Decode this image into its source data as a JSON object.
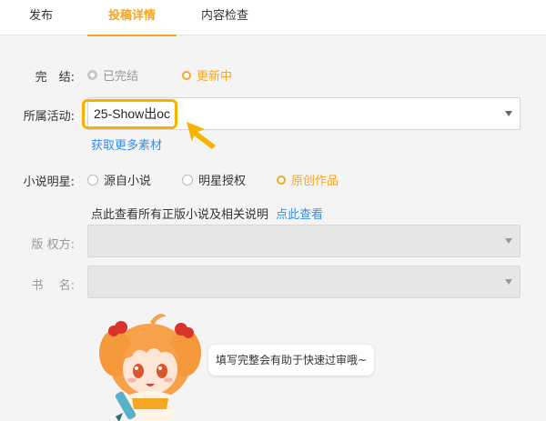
{
  "tabs": [
    {
      "label": "发布"
    },
    {
      "label": "投稿详情"
    },
    {
      "label": "内容检查"
    }
  ],
  "form": {
    "completion": {
      "label": "完　结:",
      "options": [
        "已完结",
        "更新中"
      ],
      "selected": "更新中"
    },
    "activity": {
      "label": "所属活动:",
      "value": "25-Show出oc",
      "more_link": "获取更多素材"
    },
    "novel_star": {
      "label": "小说明星:",
      "options": [
        "源自小说",
        "明星授权",
        "原创作品"
      ],
      "selected": "原创作品"
    },
    "notice": {
      "text": "点此查看所有正版小说及相关说明",
      "link": "点此查看"
    },
    "copyright": {
      "label": "版 权方:"
    },
    "book_name": {
      "label": "书　 名:"
    }
  },
  "mascot": {
    "tip": "填写完整会有助于快速过审哦~"
  },
  "colors": {
    "accent": "#f5a623",
    "link": "#3b8be3",
    "highlight": "#f5b300"
  }
}
